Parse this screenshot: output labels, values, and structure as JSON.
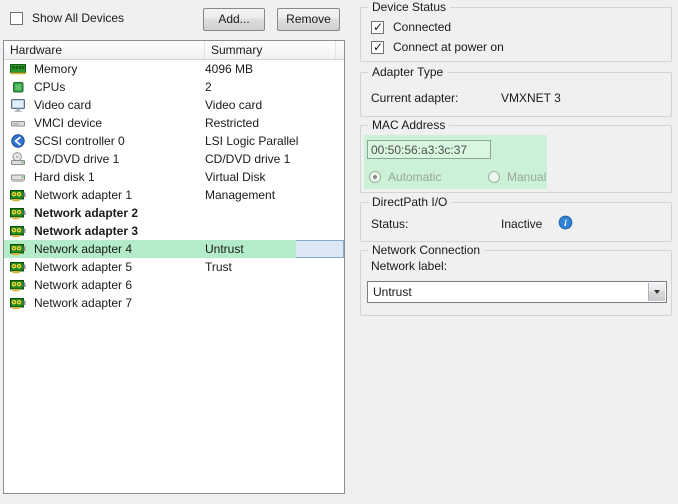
{
  "toolbar": {
    "show_all_devices_label": "Show All Devices",
    "show_all_devices_checked": false,
    "add_button": "Add...",
    "remove_button": "Remove"
  },
  "hardware_table": {
    "columns": {
      "hardware": "Hardware",
      "summary": "Summary"
    },
    "rows": [
      {
        "icon": "memory-icon",
        "name": "Memory",
        "summary": "4096 MB"
      },
      {
        "icon": "cpu-icon",
        "name": "CPUs",
        "summary": "2"
      },
      {
        "icon": "video-card-icon",
        "name": "Video card",
        "summary": "Video card"
      },
      {
        "icon": "vmci-device-icon",
        "name": "VMCI device",
        "summary": "Restricted"
      },
      {
        "icon": "scsi-controller-icon",
        "name": "SCSI controller 0",
        "summary": "LSI Logic Parallel"
      },
      {
        "icon": "cd-dvd-drive-icon",
        "name": "CD/DVD drive 1",
        "summary": "CD/DVD drive 1"
      },
      {
        "icon": "hard-disk-icon",
        "name": "Hard disk 1",
        "summary": "Virtual Disk"
      },
      {
        "icon": "network-adapter-icon",
        "name": "Network adapter 1",
        "summary": "Management"
      },
      {
        "icon": "network-adapter-icon",
        "name": "Network adapter 2",
        "summary": "",
        "bold": true
      },
      {
        "icon": "network-adapter-icon",
        "name": "Network adapter 3",
        "summary": "",
        "bold": true
      },
      {
        "icon": "network-adapter-icon",
        "name": "Network adapter 4",
        "summary": "Untrust",
        "selected": true,
        "highlighted": true
      },
      {
        "icon": "network-adapter-icon",
        "name": "Network adapter 5",
        "summary": "Trust"
      },
      {
        "icon": "network-adapter-icon",
        "name": "Network adapter 6",
        "summary": ""
      },
      {
        "icon": "network-adapter-icon",
        "name": "Network adapter 7",
        "summary": ""
      }
    ]
  },
  "device_status": {
    "title": "Device Status",
    "options": [
      {
        "label": "Connected",
        "checked": true
      },
      {
        "label": "Connect at power on",
        "checked": true
      }
    ]
  },
  "adapter_type": {
    "title": "Adapter Type",
    "current_adapter_label": "Current adapter:",
    "current_adapter_value": "VMXNET 3"
  },
  "mac_address": {
    "title": "MAC Address",
    "value": "00:50:56:a3:3c:37",
    "enabled": false,
    "mode_options": [
      {
        "label": "Automatic",
        "selected": true
      },
      {
        "label": "Manual",
        "selected": false
      }
    ]
  },
  "directpath_io": {
    "title": "DirectPath I/O",
    "status_label": "Status:",
    "status_value": "Inactive"
  },
  "network_connection": {
    "title": "Network Connection",
    "network_label": "Network label:",
    "selected_value": "Untrust"
  },
  "colors": {
    "annotation_highlight_green": "#b4ecc9",
    "mac_highlight_green": "#cbf2d6",
    "selection_blue": "#dce8f4",
    "selection_border": "#82accd",
    "info_blue": "#2f82d6",
    "dialog_background": "#f0f0f0"
  }
}
